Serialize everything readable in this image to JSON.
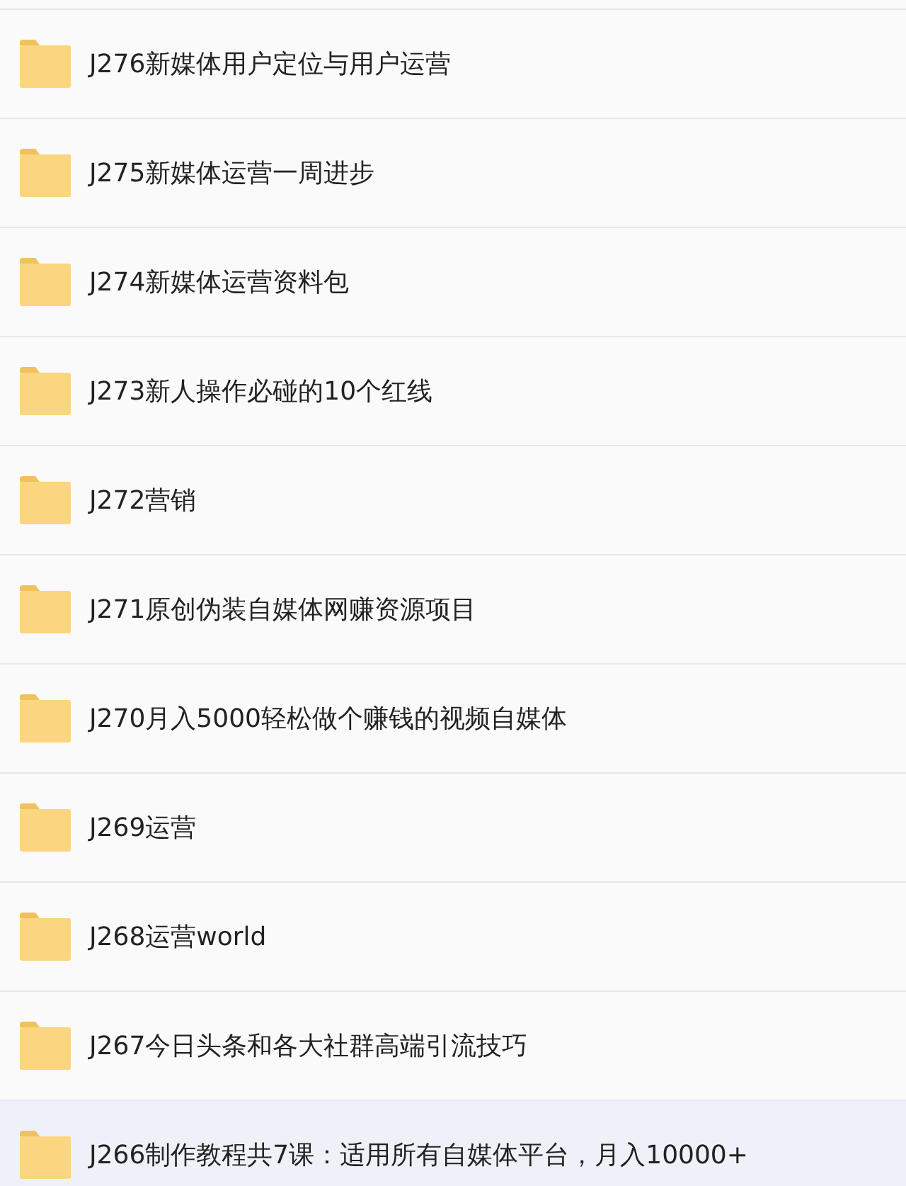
{
  "folders": [
    {
      "name": "J276新媒体用户定位与用户运营",
      "selected": false
    },
    {
      "name": "J275新媒体运营一周进步",
      "selected": false
    },
    {
      "name": "J274新媒体运营资料包",
      "selected": false
    },
    {
      "name": "J273新人操作必碰的10个红线",
      "selected": false
    },
    {
      "name": "J272营销",
      "selected": false
    },
    {
      "name": "J271原创伪装自媒体网赚资源项目",
      "selected": false
    },
    {
      "name": "J270月入5000轻松做个赚钱的视频自媒体",
      "selected": false
    },
    {
      "name": "J269运营",
      "selected": false
    },
    {
      "name": "J268运营world",
      "selected": false
    },
    {
      "name": "J267今日头条和各大社群高端引流技巧",
      "selected": false
    },
    {
      "name": "J266制作教程共7课：适用所有自媒体平台，月入10000+",
      "selected": true
    }
  ]
}
